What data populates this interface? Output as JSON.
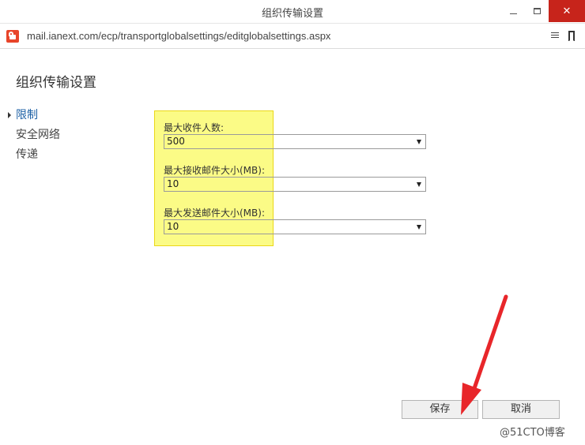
{
  "window": {
    "title": "组织传输设置",
    "close_glyph": "✕"
  },
  "address": {
    "url": "mail.ianext.com/ecp/transportglobalsettings/editglobalsettings.aspx"
  },
  "page": {
    "title": "组织传输设置"
  },
  "nav": {
    "items": [
      {
        "label": "限制"
      },
      {
        "label": "安全网络"
      },
      {
        "label": "传递"
      }
    ]
  },
  "fields": [
    {
      "label": "最大收件人数:",
      "value": "500"
    },
    {
      "label": "最大接收邮件大小(MB):",
      "value": "10"
    },
    {
      "label": "最大发送邮件大小(MB):",
      "value": "10"
    }
  ],
  "buttons": {
    "save": "保存",
    "cancel": "取消"
  },
  "watermark": "@51CTO博客",
  "colors": {
    "highlight": "#fbfb7a",
    "arrow": "#e8262a",
    "close": "#c7241b",
    "nav_active": "#1b5fa5"
  }
}
